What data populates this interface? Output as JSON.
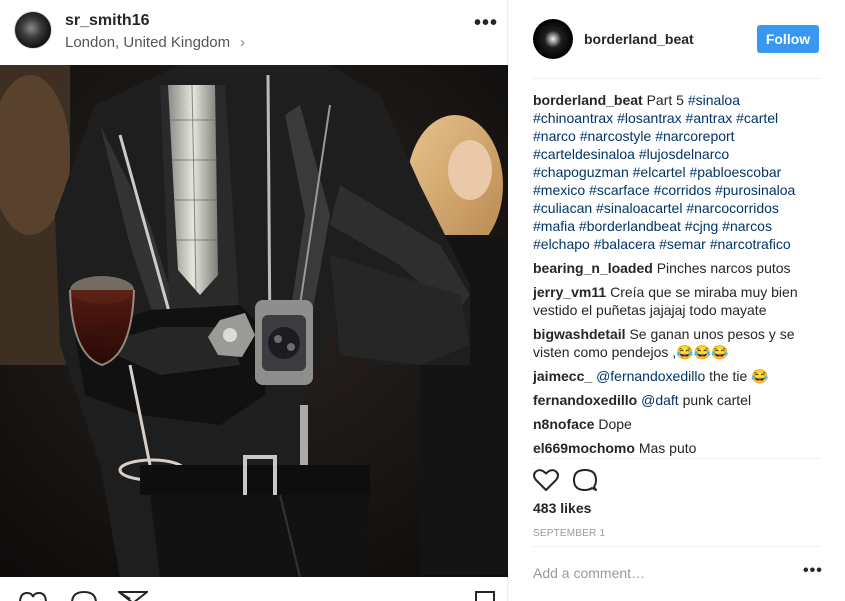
{
  "left_post": {
    "username": "sr_smith16",
    "location": "London, United Kingdom",
    "location_chevron": "›",
    "more_glyph": "•••"
  },
  "right_post": {
    "username": "borderland_beat",
    "follow_label": "Follow",
    "caption": {
      "username": "borderland_beat",
      "text": "Part 5",
      "hashtags": [
        "#sinaloa",
        "#chinoantrax",
        "#losantrax",
        "#antrax",
        "#cartel",
        "#narco",
        "#narcostyle",
        "#narcoreport",
        "#carteldesinaloa",
        "#lujosdelnarco",
        "#chapoguzman",
        "#elcartel",
        "#pabloescobar",
        "#mexico",
        "#scarface",
        "#corridos",
        "#purosinaloa",
        "#culiacan",
        "#sinaloacartel",
        "#narcocorridos",
        "#mafia",
        "#borderlandbeat",
        "#cjng",
        "#narcos",
        "#elchapo",
        "#balacera",
        "#semar",
        "#narcotrafico"
      ]
    },
    "comments": [
      {
        "username": "bearing_n_loaded",
        "text": "Pinches narcos putos"
      },
      {
        "username": "jerry_vm11",
        "text": "Creía que se miraba muy bien vestido el puñetas jajajaj todo mayate"
      },
      {
        "username": "bigwashdetail",
        "text": "Se ganan unos pesos y se visten como pendejos ,😂😂😂"
      },
      {
        "username": "jaimecc_",
        "mention": "@fernandoxedillo",
        "text": "the tie 😂"
      },
      {
        "username": "fernandoxedillo",
        "mention": "@daft",
        "text": "punk cartel"
      },
      {
        "username": "n8noface",
        "text": "Dope"
      },
      {
        "username": "el669mochomo",
        "text": "Mas puto"
      }
    ],
    "likes": "483 likes",
    "date": "SEPTEMBER 1",
    "add_comment_placeholder": "Add a comment…",
    "more_glyph": "•••"
  },
  "icons": {
    "like": "heart-icon",
    "comment": "comment-icon",
    "share": "paper-plane-icon",
    "save": "bookmark-icon"
  },
  "colors": {
    "follow": "#3897f0",
    "hashtag": "#003569",
    "text": "#262626",
    "muted": "#999999"
  }
}
